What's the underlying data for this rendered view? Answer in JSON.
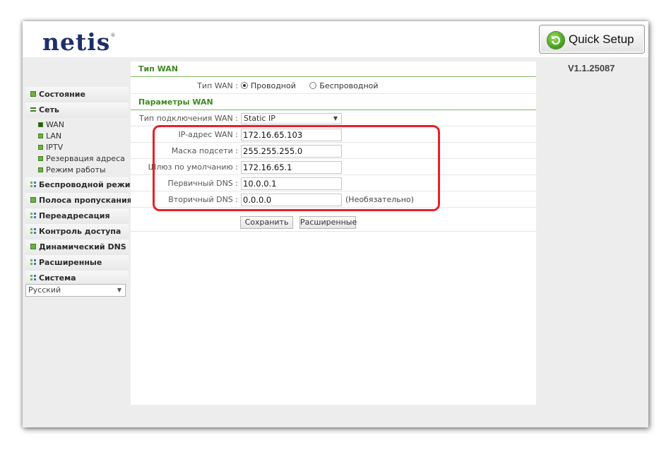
{
  "header": {
    "logo": "netis",
    "logo_mark": "®",
    "quick_setup_label": "Quick Setup",
    "version": "V1.1.25087"
  },
  "sidebar": {
    "items": [
      {
        "label": "Состояние",
        "icon": "green-square-icon"
      },
      {
        "label": "Сеть",
        "icon": "expanded-icon",
        "children": [
          {
            "label": "WAN",
            "active": true
          },
          {
            "label": "LAN"
          },
          {
            "label": "IPTV"
          },
          {
            "label": "Резервация адреса"
          },
          {
            "label": "Режим работы"
          }
        ]
      },
      {
        "label": "Беспроводной режим",
        "icon": "grid-icon"
      },
      {
        "label": "Полоса пропускания",
        "icon": "green-square-icon"
      },
      {
        "label": "Переадресация",
        "icon": "grid-icon"
      },
      {
        "label": "Контроль доступа",
        "icon": "grid-icon"
      },
      {
        "label": "Динамический DNS",
        "icon": "green-square-icon"
      },
      {
        "label": "Расширенные",
        "icon": "grid-icon"
      },
      {
        "label": "Система",
        "icon": "grid-icon"
      }
    ],
    "language": "Русский"
  },
  "wan_type": {
    "title": "Тип WAN",
    "label": "Тип WAN :",
    "options": [
      "Проводной",
      "Беспроводной"
    ],
    "selected": "Проводной"
  },
  "wan_params": {
    "title": "Параметры WAN",
    "connection_type_label": "Тип подключения WAN :",
    "connection_type_value": "Static IP",
    "fields": [
      {
        "label": "IP-адрес WAN :",
        "value": "172.16.65.103"
      },
      {
        "label": "Маска подсети :",
        "value": "255.255.255.0"
      },
      {
        "label": "Шлюз по умолчанию :",
        "value": "172.16.65.1"
      },
      {
        "label": "Первичный DNS :",
        "value": "10.0.0.1"
      },
      {
        "label": "Вторичный DNS :",
        "value": "0.0.0.0"
      }
    ],
    "optional_note": "(Необязательно)",
    "save_label": "Сохранить",
    "advanced_label": "Расширенные"
  },
  "colors": {
    "accent_green": "#3d8a21",
    "highlight_red": "#e8202a",
    "logo_navy": "#1d2f6b"
  }
}
